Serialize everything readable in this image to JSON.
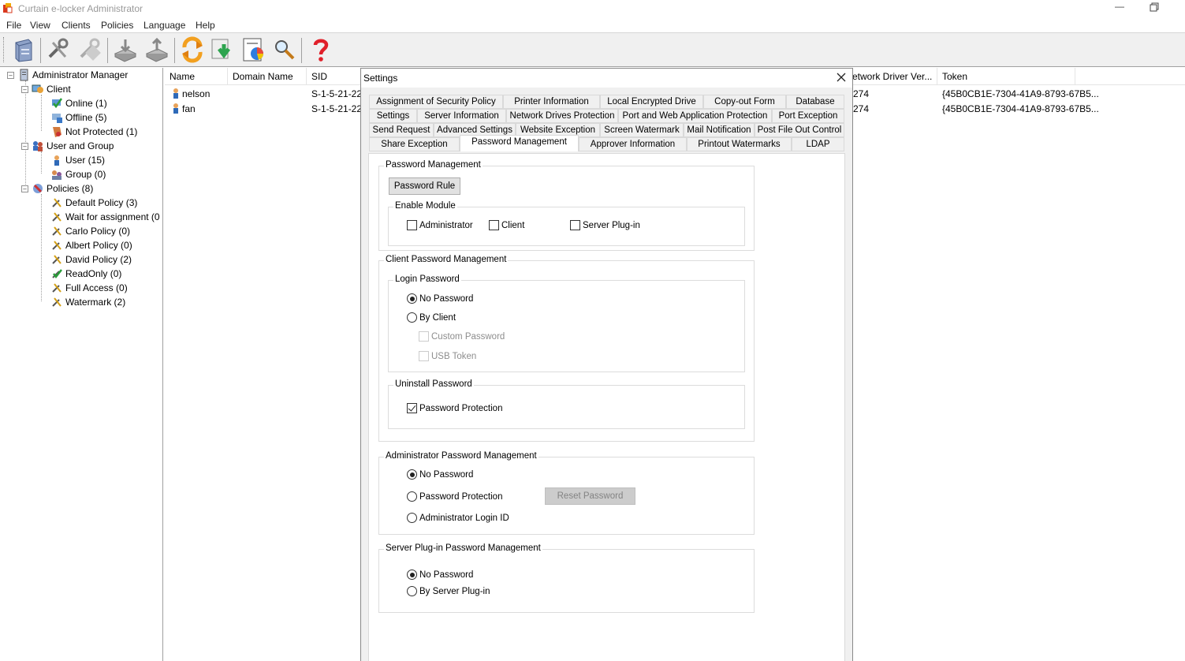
{
  "window": {
    "title": "Curtain e-locker Administrator"
  },
  "menu": [
    "File",
    "View",
    "Clients",
    "Policies",
    "Language",
    "Help"
  ],
  "toolbar": {
    "buttons": [
      "server-icon",
      "tools-icon",
      "tools-disabled-icon",
      "import-icon",
      "export-icon",
      "refresh-icon",
      "download-icon",
      "report-icon",
      "search-icon",
      "help-icon"
    ]
  },
  "tree": {
    "root": "Administrator Manager",
    "client": "Client",
    "online": "Online (1)",
    "offline": "Offline (5)",
    "not_protected": "Not Protected (1)",
    "user_and_group": "User and Group",
    "user": "User (15)",
    "group": "Group (0)",
    "policies": "Policies (8)",
    "policy_items": [
      "Default Policy (3)",
      "Wait for assignment (0",
      "Carlo Policy (0)",
      "Albert Policy (0)",
      "David Policy (2)",
      "ReadOnly (0)",
      "Full Access (0)",
      "Watermark (2)"
    ]
  },
  "list": {
    "columns": [
      "Name",
      "Domain Name",
      "SID",
      "etwork Driver Ver...",
      "Token"
    ],
    "rows": [
      {
        "name": "nelson",
        "sid": "S-1-5-21-22",
        "driver": "274",
        "token": "{45B0CB1E-7304-41A9-8793-67B5..."
      },
      {
        "name": "fan",
        "sid": "S-1-5-21-22",
        "driver": "274",
        "token": "{45B0CB1E-7304-41A9-8793-67B5..."
      }
    ]
  },
  "dialog": {
    "title": "Settings",
    "tabs_row1": [
      "Assignment of Security Policy",
      "Printer Information",
      "Local Encrypted Drive",
      "Copy-out Form",
      "Database"
    ],
    "tabs_row2": [
      "Settings",
      "Server Information",
      "Network Drives Protection",
      "Port and Web Application Protection",
      "Port Exception"
    ],
    "tabs_row3": [
      "Send Request",
      "Advanced Settings",
      "Website Exception",
      "Screen Watermark",
      "Mail Notification",
      "Post File Out Control"
    ],
    "tabs_row4": [
      "Share Exception",
      "Password Management",
      "Approver Information",
      "Printout Watermarks",
      "LDAP"
    ],
    "pm": {
      "group_label": "Password Management",
      "rule_button": "Password Rule",
      "enable_module_label": "Enable Module",
      "module_admin": "Administrator",
      "module_client": "Client",
      "module_server": "Server Plug-in"
    },
    "cpm": {
      "group_label": "Client Password Management",
      "login_label": "Login Password",
      "no_password": "No Password",
      "by_client": "By Client",
      "custom_password": "Custom Password",
      "usb_token": "USB Token",
      "uninstall_label": "Uninstall Password",
      "password_protection": "Password Protection"
    },
    "apm": {
      "group_label": "Administrator Password Management",
      "no_password": "No Password",
      "password_protection": "Password Protection",
      "admin_login_id": "Administrator Login ID",
      "reset_button": "Reset Password"
    },
    "spm": {
      "group_label": "Server Plug-in Password Management",
      "no_password": "No Password",
      "by_server": "By Server Plug-in"
    }
  }
}
